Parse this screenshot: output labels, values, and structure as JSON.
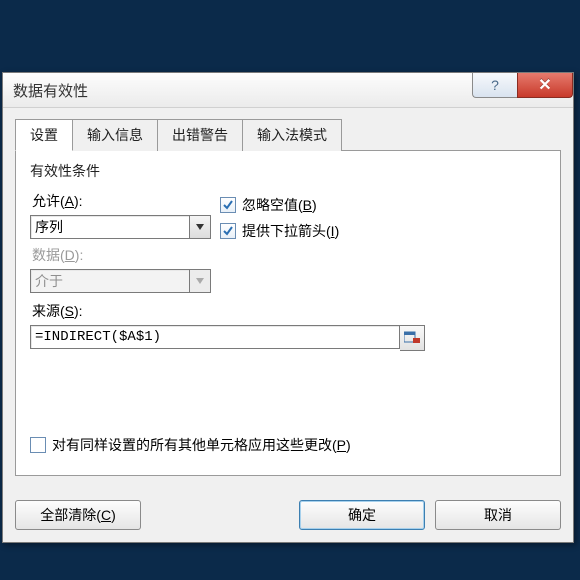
{
  "window": {
    "title": "数据有效性",
    "help_glyph": "?",
    "close_glyph": "✕"
  },
  "tabs": [
    {
      "label": "设置"
    },
    {
      "label": "输入信息"
    },
    {
      "label": "出错警告"
    },
    {
      "label": "输入法模式"
    }
  ],
  "group_label": "有效性条件",
  "allow": {
    "label_pre": "允许(",
    "hotkey": "A",
    "label_post": "):",
    "value": "序列"
  },
  "ignore_blank": {
    "label_pre": "忽略空值(",
    "hotkey": "B",
    "label_post": ")",
    "checked": true
  },
  "data_field": {
    "label_pre": "数据(",
    "hotkey": "D",
    "label_post": "):",
    "value": "介于"
  },
  "dropdown": {
    "label_pre": "提供下拉箭头(",
    "hotkey": "I",
    "label_post": ")",
    "checked": true
  },
  "source": {
    "label_pre": "来源(",
    "hotkey": "S",
    "label_post": "):",
    "value": "=INDIRECT($A$1)"
  },
  "apply_all": {
    "label_pre": "对有同样设置的所有其他单元格应用这些更改(",
    "hotkey": "P",
    "label_post": ")",
    "checked": false
  },
  "buttons": {
    "clear_pre": "全部清除(",
    "clear_hot": "C",
    "clear_post": ")",
    "ok": "确定",
    "cancel": "取消"
  }
}
